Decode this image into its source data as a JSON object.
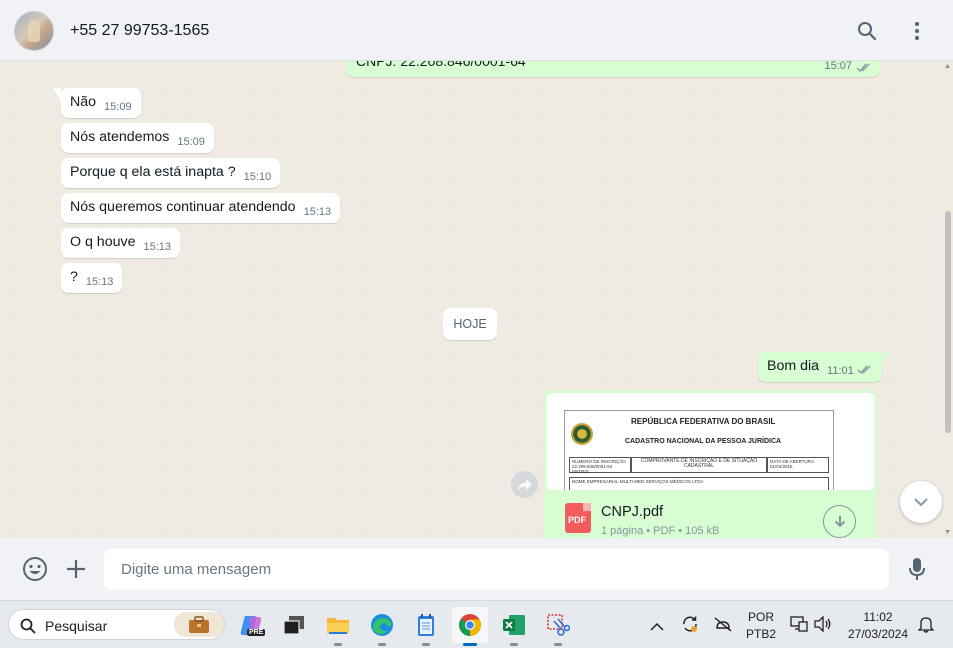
{
  "header": {
    "contact_name": "+55 27 99753-1565",
    "search_icon": "search-icon",
    "menu_icon": "kebab-menu-icon"
  },
  "top_message": {
    "text": "CNPJ: 22.208.846/0001-64",
    "time": "15:07"
  },
  "incoming_messages": [
    {
      "text": "Não",
      "time": "15:09"
    },
    {
      "text": "Nós atendemos",
      "time": "15:09"
    },
    {
      "text": "Porque q ela está inapta ?",
      "time": "15:10"
    },
    {
      "text": "Nós queremos continuar atendendo",
      "time": "15:13"
    },
    {
      "text": "O q houve",
      "time": "15:13"
    },
    {
      "text": "?",
      "time": "15:13"
    }
  ],
  "date_divider": "HOJE",
  "outgoing_message": {
    "text": "Bom dia",
    "time": "11:01"
  },
  "document": {
    "preview_title": "REPÚBLICA FEDERATIVA DO BRASIL",
    "preview_subtitle": "CADASTRO NACIONAL DA PESSOA JURÍDICA",
    "preview_box1": "NÚMERO DE INSCRIÇÃO 22.208.846/0001-64 MATRIZ",
    "preview_box2": "COMPROVANTE DE INSCRIÇÃO E DE SITUAÇÃO CADASTRAL",
    "preview_box3": "DATA DE ABERTURA 01/04/2015",
    "preview_box4": "NOME EMPRESARIAL MULTI MED SERVIÇOS MÉDICOS LTDA",
    "file_name": "CNPJ.pdf",
    "file_meta": "1 página • PDF • 105 kB",
    "badge": "PDF"
  },
  "composer": {
    "placeholder": "Digite uma mensagem"
  },
  "taskbar": {
    "search_label": "Pesquisar",
    "apps": [
      "copilot-pre",
      "task-view",
      "file-explorer",
      "edge",
      "notepad",
      "chrome",
      "excel",
      "snipping-tool"
    ],
    "copilot_badge": "PRE",
    "language_top": "POR",
    "language_bottom": "PTB2",
    "time": "11:02",
    "date": "27/03/2024"
  },
  "colors": {
    "chat_bg": "#efeae2",
    "outgoing_bubble": "#d9fdd3",
    "incoming_bubble": "#ffffff",
    "read_ticks": "#53bdeb",
    "pdf_red": "#f15c5c"
  }
}
